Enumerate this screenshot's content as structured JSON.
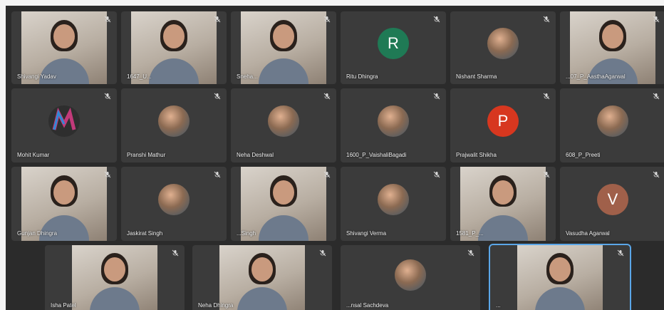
{
  "participants": [
    {
      "name": "Shivangi Yadav",
      "avatar": "video"
    },
    {
      "name": "1647_U...",
      "avatar": "video"
    },
    {
      "name": "Sneha...",
      "avatar": "video"
    },
    {
      "name": "Ritu Dhingra",
      "avatar": "letter",
      "initial": "R",
      "color": "#1f7a55"
    },
    {
      "name": "Nishant Sharma",
      "avatar": "photo"
    },
    {
      "name": "...07_P_AasthaAgarwal",
      "avatar": "video"
    },
    {
      "name": "Mohit Kumar",
      "avatar": "logo"
    },
    {
      "name": "Pranshi Mathur",
      "avatar": "photo"
    },
    {
      "name": "Neha Deshwal",
      "avatar": "photo"
    },
    {
      "name": "1600_P_VaishaliBagadi",
      "avatar": "photo"
    },
    {
      "name": "Prajwalit Shikha",
      "avatar": "letter",
      "initial": "P",
      "color": "#d7371f"
    },
    {
      "name": "608_P_Preeti",
      "avatar": "photo"
    },
    {
      "name": "Gunjan Dhingra",
      "avatar": "video"
    },
    {
      "name": "Jaskirat Singh",
      "avatar": "photo"
    },
    {
      "name": "...Singh",
      "avatar": "video"
    },
    {
      "name": "Shivangi Verma",
      "avatar": "photo"
    },
    {
      "name": "1581_P_...",
      "avatar": "video"
    },
    {
      "name": "Vasudha Agarwal",
      "avatar": "letter",
      "initial": "V",
      "color": "#a0604a"
    },
    {
      "name": "Isha Patel",
      "avatar": "video"
    },
    {
      "name": "Neha Dhingra",
      "avatar": "video"
    },
    {
      "name": "...nsal Sachdeva",
      "avatar": "photo"
    },
    {
      "name": "...",
      "avatar": "video",
      "speaking": true
    }
  ],
  "icons": {
    "mic_muted": "mic-off-icon"
  }
}
